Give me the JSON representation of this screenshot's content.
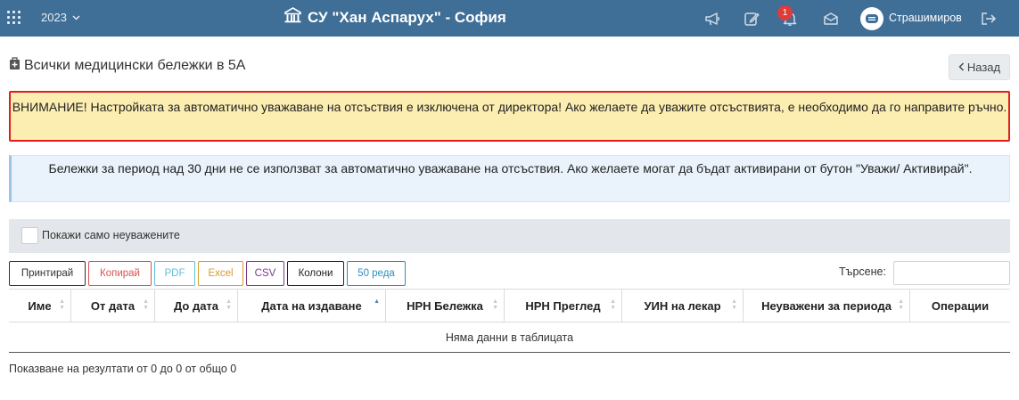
{
  "header": {
    "year": "2023",
    "school_name": "СУ \"Хан Аспарух\" - София",
    "notification_count": "1",
    "username": "Страшимиров",
    "icons": [
      "apps-grid-icon",
      "chevron-down-icon",
      "school-building-icon",
      "megaphone-icon",
      "edit-icon",
      "bell-icon",
      "envelope-icon",
      "user-avatar-icon",
      "logout-icon"
    ]
  },
  "page": {
    "title": "Всички медицински бележки в 5А",
    "back_label": "Назад"
  },
  "alerts": {
    "warning": "ВНИМАНИЕ! Настройката за автоматично уважаване на отсъствия е изключена от директора! Ако желаете да уважите отсъствията, е необходимо да го направите ръчно.",
    "info": "Бележки за период над 30 дни не се използват за автоматично уважаване на отсъствия. Ако желаете могат да бъдат активирани от бутон \"Уважи/ Активирай\"."
  },
  "filter": {
    "show_unexcused_label": "Покажи само неуважените"
  },
  "toolbar": {
    "buttons": [
      {
        "label": "Принтирай",
        "color": "#333333"
      },
      {
        "label": "Копирай",
        "color": "#d9534f"
      },
      {
        "label": "PDF",
        "color": "#5bc0de"
      },
      {
        "label": "Excel",
        "color": "#d99a2b"
      },
      {
        "label": "CSV",
        "color": "#7a3b8c"
      },
      {
        "label": "Колони",
        "color": "#222222"
      },
      {
        "label": "50 реда",
        "color": "#2a8fbd"
      }
    ],
    "search_label": "Търсене:",
    "search_value": ""
  },
  "table": {
    "columns": [
      "Име",
      "От дата",
      "До дата",
      "Дата на издаване",
      "НРН Бележка",
      "НРН Преглед",
      "УИН на лекар",
      "Неуважени за периода",
      "Операции"
    ],
    "empty_message": "Няма данни в таблицата",
    "info": "Показване на резултати от 0 до 0 от общо 0"
  }
}
